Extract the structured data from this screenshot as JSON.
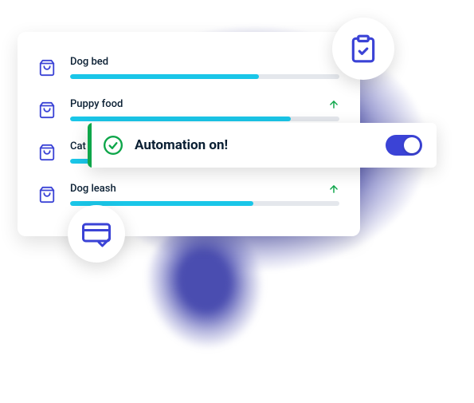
{
  "items": [
    {
      "label": "Dog bed",
      "progress": 70,
      "trend": false
    },
    {
      "label": "Puppy food",
      "progress": 82,
      "trend": true
    },
    {
      "label": "Cat food",
      "progress": 52,
      "trend": false
    },
    {
      "label": "Dog leash",
      "progress": 68,
      "trend": true
    }
  ],
  "automation": {
    "label": "Automation on!",
    "enabled": true
  }
}
